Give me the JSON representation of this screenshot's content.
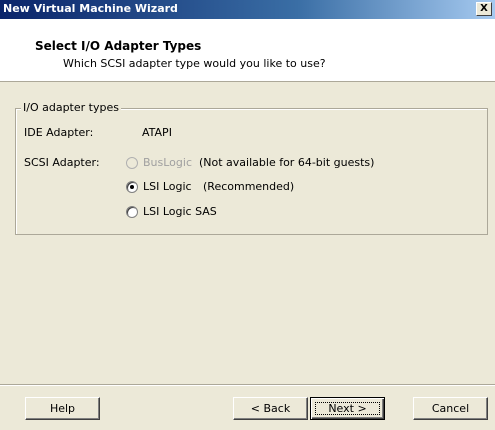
{
  "window": {
    "title": "New Virtual Machine Wizard",
    "close_label": "X"
  },
  "header": {
    "title": "Select I/O Adapter Types",
    "subtitle": "Which SCSI adapter type would you like to use?"
  },
  "group": {
    "legend": "I/O adapter types",
    "ide_label": "IDE Adapter:",
    "ide_value": "ATAPI",
    "scsi_label": "SCSI Adapter:",
    "options": [
      {
        "label": "BusLogic",
        "note": "(Not available for 64-bit guests)",
        "enabled": false,
        "checked": false
      },
      {
        "label": "LSI Logic",
        "note": "(Recommended)",
        "enabled": true,
        "checked": true
      },
      {
        "label": "LSI Logic SAS",
        "note": "",
        "enabled": true,
        "checked": false
      }
    ]
  },
  "buttons": {
    "help": "Help",
    "back": "< Back",
    "next": "Next >",
    "cancel": "Cancel"
  }
}
